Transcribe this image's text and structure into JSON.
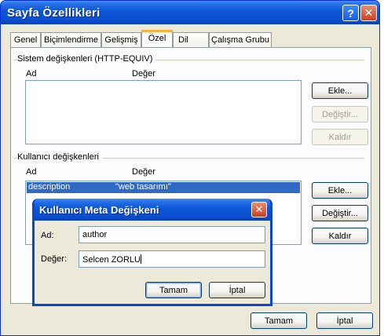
{
  "window": {
    "title": "Sayfa Özellikleri",
    "help_glyph": "?",
    "close_glyph": "✕"
  },
  "tabs": [
    {
      "label": "Genel"
    },
    {
      "label": "Biçimlendirme"
    },
    {
      "label": "Gelişmiş"
    },
    {
      "label": "Özel",
      "active": true
    },
    {
      "label": "Dil"
    },
    {
      "label": "Çalışma Grubu"
    }
  ],
  "system_vars": {
    "group_label": "Sistem değişkenleri (HTTP-EQUIV)",
    "col_name": "Ad",
    "col_value": "Değer",
    "add_label": "Ekle...",
    "modify_label": "Değiştir...",
    "remove_label": "Kaldır"
  },
  "user_vars": {
    "group_label": "Kullanıcı değişkenleri",
    "col_name": "Ad",
    "col_value": "Değer",
    "rows": [
      {
        "name": "description",
        "value": "\"web tasarımı\""
      }
    ],
    "add_label": "Ekle...",
    "modify_label": "Değiştir...",
    "remove_label": "Kaldır"
  },
  "footer": {
    "ok_label": "Tamam",
    "cancel_label": "İptal"
  },
  "dialog": {
    "title": "Kullanıcı Meta Değişkeni",
    "close_glyph": "✕",
    "name_label": "Ad:",
    "name_value": "author",
    "value_label": "Değer:",
    "value_value": "Selcen ZORLU",
    "ok_label": "Tamam",
    "cancel_label": "İptal"
  },
  "colors": {
    "titlebar": "#0b55d6",
    "selection": "#316ac5",
    "active_tab_accent": "#f7b33c"
  }
}
